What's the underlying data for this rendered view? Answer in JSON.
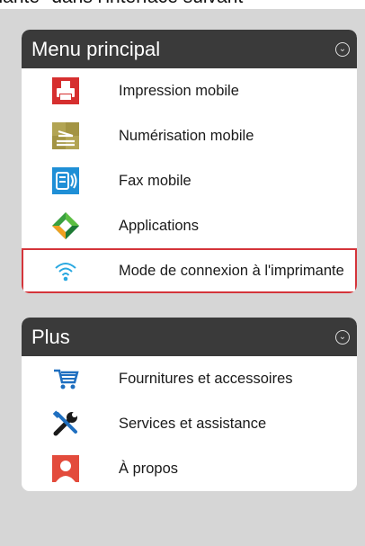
{
  "caption": "rimante\" dans l'interface suivant",
  "menu": {
    "title": "Menu principal",
    "items": [
      {
        "label": "Impression mobile",
        "icon": "printer-icon"
      },
      {
        "label": "Numérisation mobile",
        "icon": "scanner-icon"
      },
      {
        "label": "Fax mobile",
        "icon": "fax-icon"
      },
      {
        "label": "Applications",
        "icon": "applications-icon"
      },
      {
        "label": "Mode de connexion à l'imprimante",
        "icon": "wifi-icon"
      }
    ]
  },
  "plus": {
    "title": "Plus",
    "items": [
      {
        "label": "Fournitures et accessoires",
        "icon": "cart-icon"
      },
      {
        "label": "Services et assistance",
        "icon": "tools-icon"
      },
      {
        "label": "À propos",
        "icon": "person-icon"
      }
    ]
  },
  "colors": {
    "highlight": "#d4343a",
    "header": "#3a3a3a",
    "wifi": "#29a8e0"
  }
}
